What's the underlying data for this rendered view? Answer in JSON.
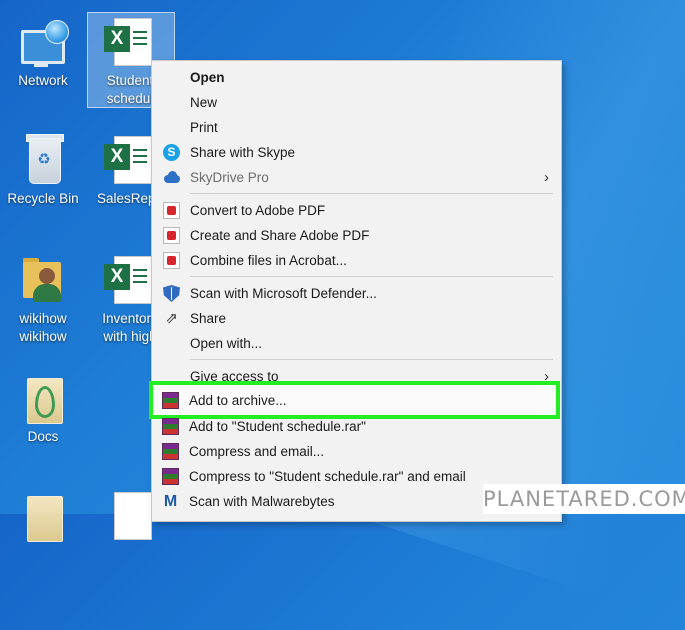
{
  "desktop": {
    "icons": [
      {
        "label": "Network",
        "icon": "network-icon"
      },
      {
        "label": "Student schedule",
        "line1": "Student",
        "line2": "schedul",
        "icon": "excel-file-icon"
      },
      {
        "label": "Recycle Bin",
        "icon": "recycle-bin-icon"
      },
      {
        "label": "SalesRepo",
        "icon": "excel-file-icon"
      },
      {
        "label": "wikihow wikihow",
        "line1": "wikihow",
        "line2": "wikihow",
        "icon": "user-folder-icon"
      },
      {
        "label": "Inventory with high",
        "line1": "Inventory",
        "line2": "with high",
        "icon": "excel-file-icon"
      },
      {
        "label": "Docs",
        "icon": "documents-folder-icon"
      }
    ]
  },
  "context_menu": {
    "items": [
      {
        "label": "Open",
        "bold": true
      },
      {
        "label": "New"
      },
      {
        "label": "Print"
      },
      {
        "label": "Share with Skype",
        "icon": "skype-icon"
      },
      {
        "label": "SkyDrive Pro",
        "icon": "cloud-icon",
        "dim": true,
        "submenu": true
      },
      {
        "label": "Convert to Adobe PDF",
        "icon": "adobe-pdf-icon"
      },
      {
        "label": "Create and Share Adobe PDF",
        "icon": "adobe-pdf-icon"
      },
      {
        "label": "Combine files in Acrobat...",
        "icon": "adobe-acrobat-icon"
      },
      {
        "label": "Scan with Microsoft Defender...",
        "icon": "defender-shield-icon"
      },
      {
        "label": "Share",
        "icon": "share-icon"
      },
      {
        "label": "Open with..."
      },
      {
        "label": "Give access to",
        "submenu": true
      },
      {
        "label": "Add to archive...",
        "icon": "winrar-icon",
        "highlighted": true
      },
      {
        "label": "Add to \"Student schedule.rar\"",
        "icon": "winrar-icon"
      },
      {
        "label": "Compress and email...",
        "icon": "winrar-icon"
      },
      {
        "label": "Compress to \"Student schedule.rar\" and email",
        "icon": "winrar-icon"
      },
      {
        "label": "Scan with Malwarebytes",
        "icon": "malwarebytes-icon"
      }
    ],
    "arrow_glyph": "›"
  },
  "highlight_color": "#22ee22",
  "watermark": "PLANETARED.COM"
}
